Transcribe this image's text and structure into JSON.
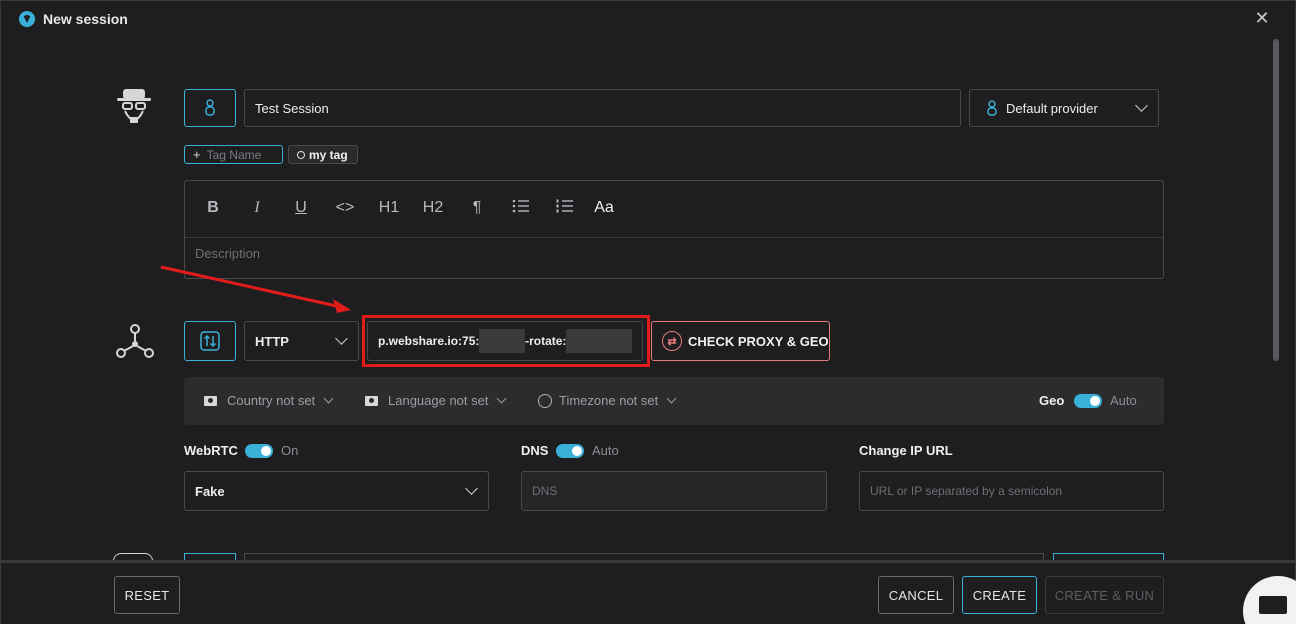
{
  "window": {
    "title": "New session"
  },
  "profile": {
    "name_value": "Test Session",
    "provider_label": "Default provider"
  },
  "tags": {
    "add_placeholder": "Tag Name",
    "items": [
      "my tag"
    ]
  },
  "editor": {
    "toolbar": [
      "B",
      "I",
      "U",
      "<>",
      "H1",
      "H2",
      "¶",
      "bullet-list",
      "numbered-list",
      "Aa"
    ],
    "description_placeholder": "Description"
  },
  "proxy": {
    "type": "HTTP",
    "value_start": "p.webshare.io:75:",
    "value_mid": "-rotate:",
    "check_label": "CHECK PROXY & GEO"
  },
  "geo": {
    "country": "Country not set",
    "language": "Language not set",
    "timezone": "Timezone not set",
    "geo_label": "Geo",
    "geo_mode": "Auto"
  },
  "webrtc": {
    "label": "WebRTC",
    "state": "On",
    "value": "Fake"
  },
  "dns": {
    "label": "DNS",
    "state": "Auto",
    "placeholder": "DNS"
  },
  "change_ip": {
    "label": "Change IP URL",
    "placeholder": "URL or IP separated by a semicolon"
  },
  "footer": {
    "reset": "RESET",
    "cancel": "CANCEL",
    "create": "CREATE",
    "create_run": "CREATE & RUN"
  },
  "colors": {
    "accent": "#3ab0d8",
    "danger": "#e21b1b",
    "background": "#1e1e20"
  }
}
